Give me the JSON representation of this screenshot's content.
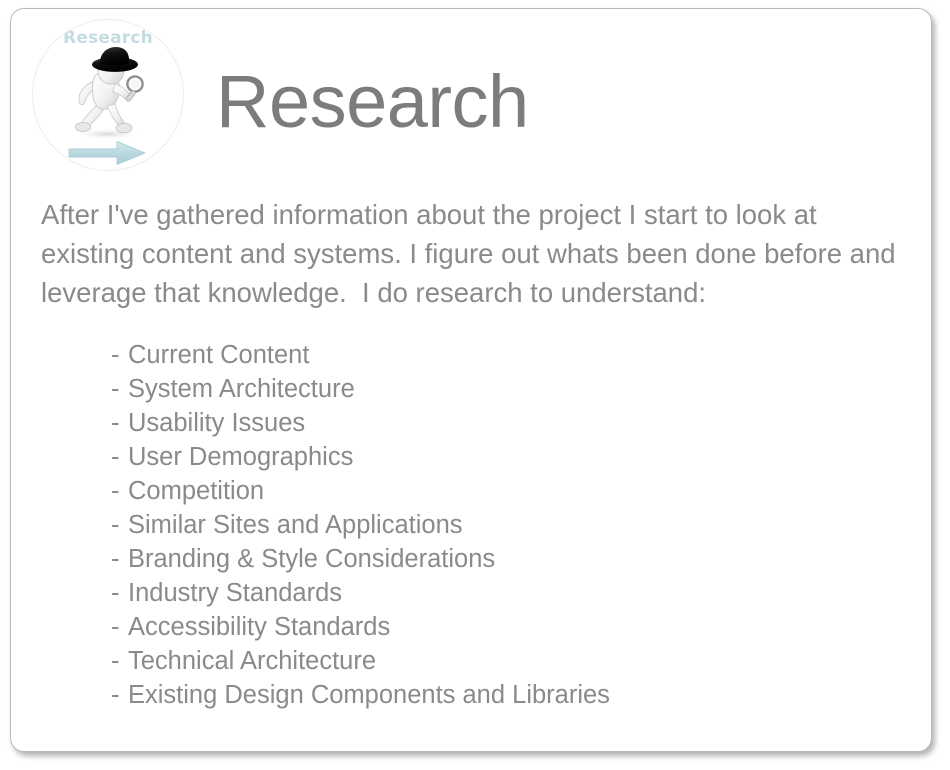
{
  "slide": {
    "title": "Research",
    "logo": {
      "label": "Research",
      "figure_icon": "detective-walking-icon",
      "hat_icon": "fedora-hat-icon",
      "magnifier_icon": "magnifying-glass-icon",
      "arrow_icon": "arrow-right-icon",
      "accent_color": "#c3dce1",
      "circle_border_color": "#ededed"
    },
    "paragraph": "After I've gathered information about the project I start to look at existing content and systems. I figure out whats been done before and leverage that knowledge.  I do research to understand:",
    "list_prefix": "-",
    "list_items": [
      "Current Content",
      "System Architecture",
      "Usability Issues",
      "User Demographics",
      "Competition",
      "Similar Sites and Applications",
      "Branding & Style Considerations",
      "Industry Standards",
      "Accessibility Standards",
      "Technical Architecture",
      "Existing Design Components and Libraries"
    ],
    "colors": {
      "title": "#7c7c7c",
      "text": "#8a8a8a",
      "accent": "#c3dce1",
      "card_border": "#b9b9b9",
      "background": "#ffffff"
    }
  }
}
